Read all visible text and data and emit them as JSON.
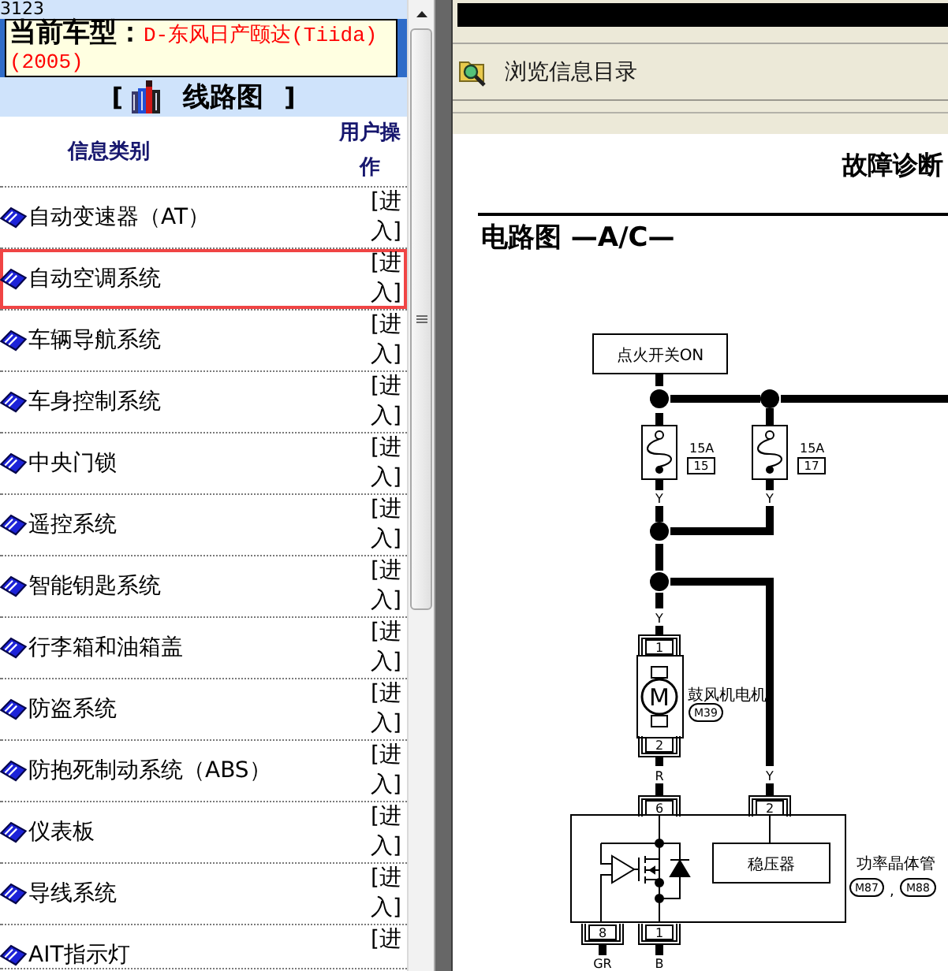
{
  "left_panel": {
    "top_text": "3123",
    "vehicle": {
      "text": "**当前车型：**D-东风日产颐达(Tiida)(2005)"
    },
    "section_title": {
      "open_bracket": "[",
      "title": "线路图",
      "close_bracket": "]"
    },
    "table": {
      "columns": [
        "信息类别",
        "用户操作"
      ],
      "rows": [
        {
          "category": "自动变速器（AT）",
          "action": "[进入]",
          "selected": false
        },
        {
          "category": "自动空调系统",
          "action": "[进入]",
          "selected": true
        },
        {
          "category": "车辆导航系统",
          "action": "[进入]",
          "selected": false
        },
        {
          "category": "车身控制系统",
          "action": "[进入]",
          "selected": false
        },
        {
          "category": "中央门锁",
          "action": "[进入]",
          "selected": false
        },
        {
          "category": "遥控系统",
          "action": "[进入]",
          "selected": false
        },
        {
          "category": "智能钥匙系统",
          "action": "[进入]",
          "selected": false
        },
        {
          "category": "行李箱和油箱盖",
          "action": "[进入]",
          "selected": false
        },
        {
          "category": "防盗系统",
          "action": "[进入]",
          "selected": false
        },
        {
          "category": "防抱死制动系统（ABS）",
          "action": "[进入]",
          "selected": false
        },
        {
          "category": "仪表板",
          "action": "[进入]",
          "selected": false
        },
        {
          "category": "导线系统",
          "action": "[进入]",
          "selected": false
        },
        {
          "category": "AIT指示灯",
          "action": "[进",
          "selected": false
        }
      ]
    }
  },
  "right_panel": {
    "toolbar": {
      "label": "浏览信息目录"
    },
    "document": {
      "header": "故障诊断",
      "title": "电路图 —A/C—",
      "diagram": {
        "power_source": "点火开关ON",
        "fuses": [
          {
            "rating": "15A",
            "number": "15",
            "wire_color": "Y"
          },
          {
            "rating": "15A",
            "number": "17",
            "wire_color": "Y"
          }
        ],
        "blower_motor": {
          "name": "鼓风机电机",
          "connector": "M39",
          "symbol": "M",
          "wire_in": "Y",
          "pin_in": "1",
          "pin_out": "2",
          "wire_out": "R"
        },
        "power_transistor": {
          "name": "功率晶体管",
          "connectors": [
            "M87",
            "M88"
          ],
          "separator": ",",
          "regulator": "稳压器",
          "top_pins": [
            {
              "pin": "6"
            },
            {
              "pin": "2",
              "wire_color": "Y"
            }
          ],
          "bottom_pins": [
            {
              "pin": "8",
              "wire_color": "GR"
            },
            {
              "pin": "1",
              "wire_color": "B"
            }
          ]
        }
      }
    }
  }
}
